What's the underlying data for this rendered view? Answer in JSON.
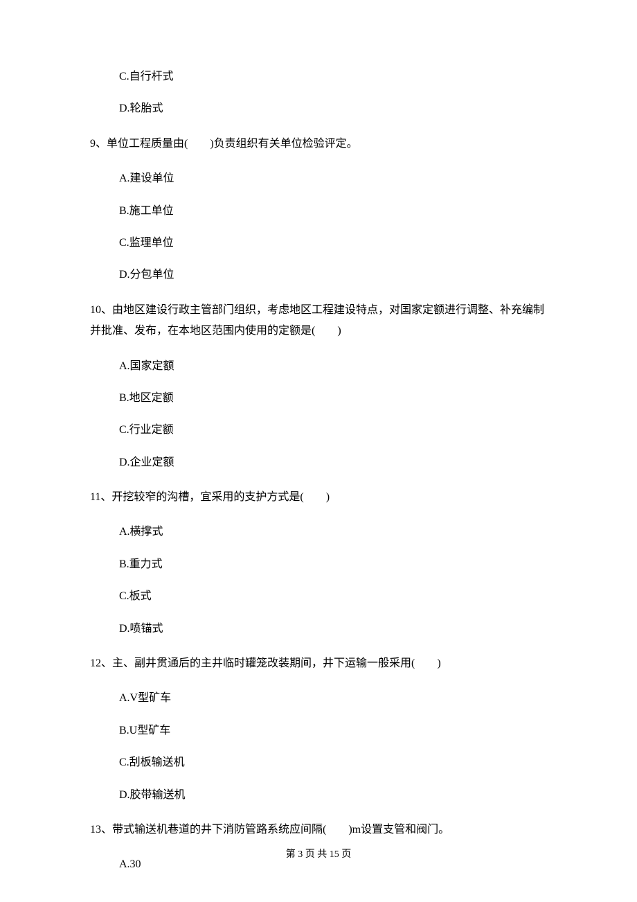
{
  "q8_options": {
    "c": "C.自行杆式",
    "d": "D.轮胎式"
  },
  "q9": {
    "text": "9、单位工程质量由(　　)负责组织有关单位检验评定。",
    "options": {
      "a": "A.建设单位",
      "b": "B.施工单位",
      "c": "C.监理单位",
      "d": "D.分包单位"
    }
  },
  "q10": {
    "text": "10、由地区建设行政主管部门组织，考虑地区工程建设特点，对国家定额进行调整、补充编制并批准、发布，在本地区范围内使用的定额是(　　)",
    "options": {
      "a": "A.国家定额",
      "b": "B.地区定额",
      "c": "C.行业定额",
      "d": "D.企业定额"
    }
  },
  "q11": {
    "text": "11、开挖较窄的沟槽，宜采用的支护方式是(　　)",
    "options": {
      "a": "A.横撑式",
      "b": "B.重力式",
      "c": "C.板式",
      "d": "D.喷锚式"
    }
  },
  "q12": {
    "text": "12、主、副井贯通后的主井临时罐笼改装期间，井下运输一般采用(　　)",
    "options": {
      "a": "A.V型矿车",
      "b": "B.U型矿车",
      "c": "C.刮板输送机",
      "d": "D.胶带输送机"
    }
  },
  "q13": {
    "text": "13、带式输送机巷道的井下消防管路系统应间隔(　　)m设置支管和阀门。",
    "options": {
      "a": "A.30"
    }
  },
  "footer": "第 3 页 共 15 页"
}
